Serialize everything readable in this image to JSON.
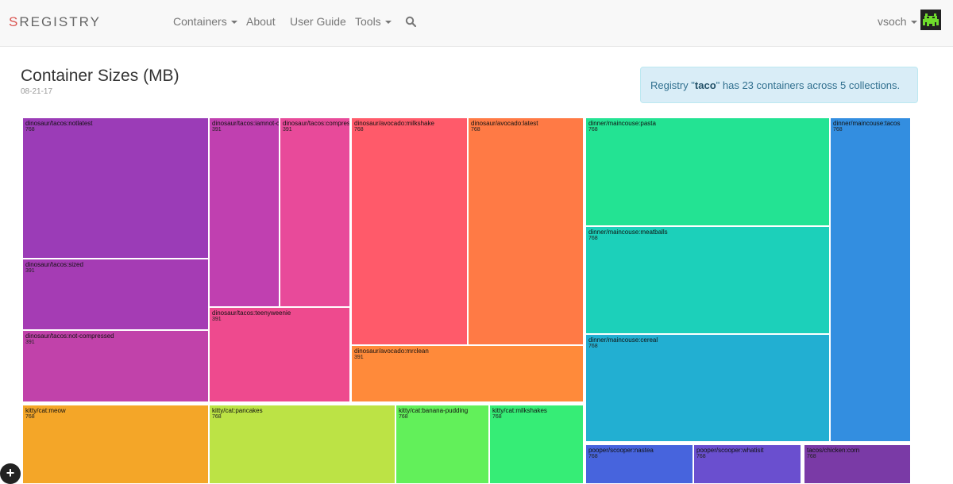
{
  "navbar": {
    "brand_first": "S",
    "brand_rest": "REGISTRY",
    "items": [
      {
        "label": "Containers",
        "dropdown": true
      },
      {
        "label": "About",
        "dropdown": false
      },
      {
        "label": "User Guide",
        "dropdown": false
      },
      {
        "label": "Tools",
        "dropdown": true
      }
    ],
    "user": "vsoch",
    "search_icon": "search-icon",
    "avatar_icon": "space-invader-icon"
  },
  "header": {
    "title": "Container Sizes (MB)",
    "date": "08-21-17"
  },
  "alert": {
    "prefix": "Registry \"",
    "registry": "taco",
    "suffix": "\" has 23 containers across 5 collections."
  },
  "treemap": {
    "cells": [
      {
        "name": "dinosaur/tacos:notlatest",
        "size": "768",
        "color": "#9b3cb7"
      },
      {
        "name": "dinosaur/tacos:iamnot-compressed",
        "size": "391",
        "color": "#c040b0"
      },
      {
        "name": "dinosaur/tacos:compressed",
        "size": "391",
        "color": "#e84a9a"
      },
      {
        "name": "dinosaur/tacos:sized",
        "size": "391",
        "color": "#a53cb4"
      },
      {
        "name": "dinosaur/tacos:not-compressed",
        "size": "391",
        "color": "#c142aa"
      },
      {
        "name": "dinosaur/tacos:teenyweenie",
        "size": "391",
        "color": "#ee4a8e"
      },
      {
        "name": "dinosaur/avocado:milkshake",
        "size": "768",
        "color": "#ff5a6a"
      },
      {
        "name": "dinosaur/avocado:latest",
        "size": "768",
        "color": "#ff7a45"
      },
      {
        "name": "dinosaur/avocado:mrclean",
        "size": "391",
        "color": "#ff8a3a"
      },
      {
        "name": "dinner/maincouse:pasta",
        "size": "768",
        "color": "#23e393"
      },
      {
        "name": "dinner/maincouse:meatballs",
        "size": "768",
        "color": "#1cd0ba"
      },
      {
        "name": "dinner/maincouse:cereal",
        "size": "768",
        "color": "#22afd2"
      },
      {
        "name": "dinner/maincouse:tacos",
        "size": "768",
        "color": "#338ee0"
      },
      {
        "name": "kitty/cat:meow",
        "size": "768",
        "color": "#f4a628"
      },
      {
        "name": "kitty/cat:pancakes",
        "size": "768",
        "color": "#bce345"
      },
      {
        "name": "kitty/cat:banana-pudding",
        "size": "768",
        "color": "#62f05a"
      },
      {
        "name": "kitty/cat:milkshakes",
        "size": "768",
        "color": "#36ed76"
      },
      {
        "name": "pooper/scooper:nastea",
        "size": "768",
        "color": "#4764dd"
      },
      {
        "name": "pooper/scooper:whatisit",
        "size": "768",
        "color": "#6a4fcf"
      },
      {
        "name": "tacos/chicken:corn",
        "size": "768",
        "color": "#7a3aa6"
      }
    ]
  },
  "fab_label": "+"
}
